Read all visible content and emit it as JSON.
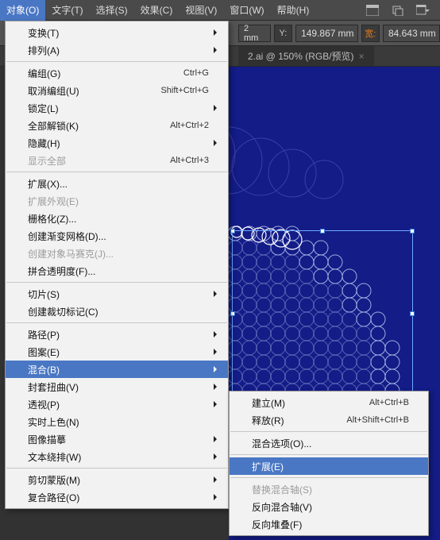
{
  "menubar": {
    "items": [
      {
        "label": "对象(O)",
        "hl": true
      },
      {
        "label": "文字(T)"
      },
      {
        "label": "选择(S)"
      },
      {
        "label": "效果(C)"
      },
      {
        "label": "视图(V)"
      },
      {
        "label": "窗口(W)"
      },
      {
        "label": "帮助(H)"
      }
    ]
  },
  "options": {
    "x_unit": "2 mm",
    "y_label": "Y:",
    "y_val": "149.867",
    "y_unit": "mm",
    "w_label": "宽:",
    "w_val": "84.643",
    "w_unit": "mm"
  },
  "tab": {
    "title": "2.ai @ 150% (RGB/预览)",
    "close": "×"
  },
  "menu1": [
    {
      "t": "sub",
      "label": "变换(T)"
    },
    {
      "t": "sub",
      "label": "排列(A)"
    },
    {
      "t": "sep"
    },
    {
      "t": "item",
      "label": "编组(G)",
      "sc": "Ctrl+G"
    },
    {
      "t": "item",
      "label": "取消编组(U)",
      "sc": "Shift+Ctrl+G"
    },
    {
      "t": "sub",
      "label": "锁定(L)"
    },
    {
      "t": "item",
      "label": "全部解锁(K)",
      "sc": "Alt+Ctrl+2"
    },
    {
      "t": "sub",
      "label": "隐藏(H)"
    },
    {
      "t": "item",
      "label": "显示全部",
      "sc": "Alt+Ctrl+3",
      "disabled": true
    },
    {
      "t": "sep"
    },
    {
      "t": "item",
      "label": "扩展(X)..."
    },
    {
      "t": "item",
      "label": "扩展外观(E)",
      "disabled": true
    },
    {
      "t": "item",
      "label": "栅格化(Z)..."
    },
    {
      "t": "item",
      "label": "创建渐变网格(D)..."
    },
    {
      "t": "item",
      "label": "创建对象马赛克(J)...",
      "disabled": true
    },
    {
      "t": "item",
      "label": "拼合透明度(F)..."
    },
    {
      "t": "sep"
    },
    {
      "t": "sub",
      "label": "切片(S)"
    },
    {
      "t": "item",
      "label": "创建裁切标记(C)"
    },
    {
      "t": "sep"
    },
    {
      "t": "sub",
      "label": "路径(P)"
    },
    {
      "t": "sub",
      "label": "图案(E)"
    },
    {
      "t": "sub",
      "label": "混合(B)",
      "hl": true
    },
    {
      "t": "sub",
      "label": "封套扭曲(V)"
    },
    {
      "t": "sub",
      "label": "透视(P)"
    },
    {
      "t": "item",
      "label": "实时上色(N)"
    },
    {
      "t": "sub",
      "label": "图像描摹"
    },
    {
      "t": "sub",
      "label": "文本绕排(W)"
    },
    {
      "t": "sep"
    },
    {
      "t": "sub",
      "label": "剪切蒙版(M)"
    },
    {
      "t": "sub",
      "label": "复合路径(O)"
    }
  ],
  "submenu": [
    {
      "t": "item",
      "label": "建立(M)",
      "sc": "Alt+Ctrl+B"
    },
    {
      "t": "item",
      "label": "释放(R)",
      "sc": "Alt+Shift+Ctrl+B"
    },
    {
      "t": "sep"
    },
    {
      "t": "item",
      "label": "混合选项(O)..."
    },
    {
      "t": "sep"
    },
    {
      "t": "item",
      "label": "扩展(E)",
      "hl": true
    },
    {
      "t": "sep"
    },
    {
      "t": "item",
      "label": "替换混合轴(S)",
      "disabled": true
    },
    {
      "t": "item",
      "label": "反向混合轴(V)"
    },
    {
      "t": "item",
      "label": "反向堆叠(F)"
    }
  ]
}
